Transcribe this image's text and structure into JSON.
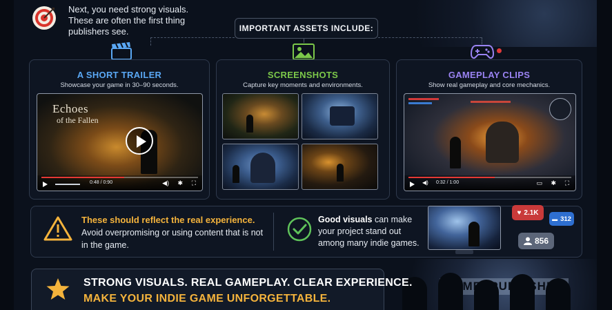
{
  "intro": {
    "text": "Next, you need strong visuals. These are often the first thing publishers see."
  },
  "assets_label": "IMPORTANT ASSETS INCLUDE:",
  "sections": {
    "trailer": {
      "title": "A SHORT TRAILER",
      "subtitle": "Showcase your game in 30–90 seconds.",
      "title_color": "#5aa8f5",
      "video_title_line1": "Echoes",
      "video_title_line2": "of the Fallen",
      "time": "0:48 / 0:90",
      "progress": 0.53
    },
    "screenshots": {
      "title": "SCREENSHOTS",
      "subtitle": "Capture key moments and environments.",
      "title_color": "#7cc84a"
    },
    "gameplay": {
      "title": "GAMEPLAY CLIPS",
      "subtitle": "Show real gameplay and core mechanics.",
      "title_color": "#9a83f2",
      "time": "0:32 / 1:00",
      "progress": 0.53
    }
  },
  "warning": {
    "title": "These should reflect the real experience.",
    "body": "Avoid overpromising or using content that is not in the game."
  },
  "good": {
    "highlight": "Good visuals",
    "rest": " can make your project stand out among many indie games."
  },
  "social": {
    "likes": "2.1K",
    "comments": "312",
    "followers": "856"
  },
  "banner": {
    "line1": "STRONG VISUALS. REAL GAMEPLAY.  CLEAR EXPERIENCE.",
    "line2": "MAKE YOUR INDIE GAME UNFORGETTABLE."
  },
  "background_sign": "GAMESPUBLISHER",
  "colors": {
    "accent_gold": "#f4b33c",
    "success_green": "#5fc25a",
    "progress_red": "#e53935",
    "like_red": "#c93a3a",
    "comment_blue": "#2e6fd1"
  },
  "icons": {
    "intro": "target-icon",
    "trailer": "clapperboard-icon",
    "screenshots": "image-icon",
    "gameplay": "gamepad-icon",
    "warning": "warning-triangle-icon",
    "good": "check-circle-icon",
    "banner": "star-icon"
  }
}
